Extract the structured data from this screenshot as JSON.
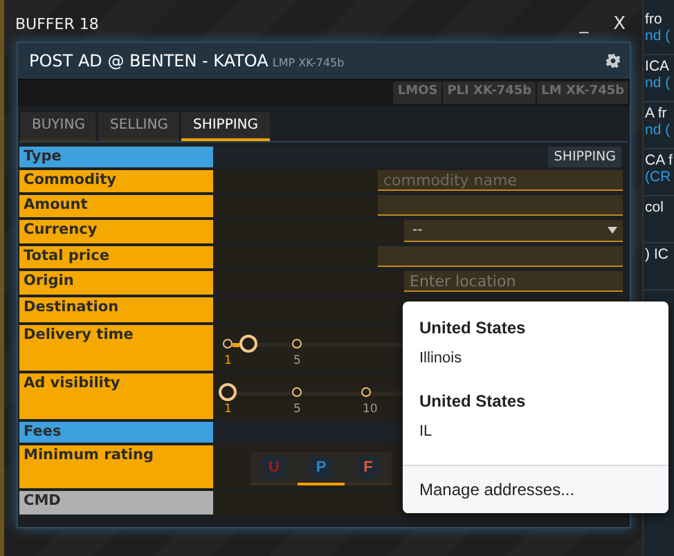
{
  "window": {
    "title": "BUFFER 18",
    "minimize": "_",
    "close": "X"
  },
  "panel": {
    "title": "POST AD @ BENTEN - KATOA",
    "subtitle": "LMP XK-745b"
  },
  "badges": [
    "LMOS",
    "PLI XK-745b",
    "LM XK-745b"
  ],
  "tabs": [
    {
      "label": "BUYING",
      "selected": false
    },
    {
      "label": "SELLING",
      "selected": false
    },
    {
      "label": "SHIPPING",
      "selected": true
    }
  ],
  "rows": [
    {
      "label": "Type",
      "kind": "section",
      "value": "SHIPPING"
    },
    {
      "label": "Commodity",
      "kind": "input",
      "placeholder": "commodity name"
    },
    {
      "label": "Amount",
      "kind": "input"
    },
    {
      "label": "Currency",
      "kind": "select",
      "value": "--"
    },
    {
      "label": "Total price",
      "kind": "input"
    },
    {
      "label": "Origin",
      "kind": "location",
      "placeholder": "Enter location"
    },
    {
      "label": "Destination",
      "kind": "empty"
    },
    {
      "label": "Delivery time",
      "kind": "slider",
      "level": 0.05,
      "ticks": [
        "1",
        "5"
      ]
    },
    {
      "label": "Ad visibility",
      "kind": "slider",
      "level": 0,
      "ticks": [
        "1",
        "5",
        "10"
      ]
    },
    {
      "label": "Fees",
      "kind": "section"
    },
    {
      "label": "Minimum rating",
      "kind": "rating",
      "options": [
        {
          "label": "U",
          "color": "#9b1c1c",
          "selected": false
        },
        {
          "label": "P",
          "color": "#2d86c8",
          "selected": true
        },
        {
          "label": "F",
          "color": "#e2553f",
          "selected": false
        }
      ]
    },
    {
      "label": "CMD",
      "kind": "command"
    }
  ],
  "suggestions": {
    "items": [
      {
        "title": "United States",
        "detail": "Illinois"
      },
      {
        "title": "United States",
        "detail": "IL"
      }
    ],
    "footer": "Manage addresses..."
  },
  "background_list": [
    {
      "lines": [
        {
          "text": "fro",
          "kind": "text"
        },
        {
          "text": "nd (",
          "kind": "link"
        }
      ]
    },
    {
      "lines": [
        {
          "text": "ICA",
          "kind": "text"
        },
        {
          "text": "nd (",
          "kind": "link"
        }
      ]
    },
    {
      "lines": [
        {
          "text": "A fr",
          "kind": "text"
        },
        {
          "text": "nd (",
          "kind": "link"
        }
      ]
    },
    {
      "lines": [
        {
          "text": "CA f",
          "kind": "text"
        },
        {
          "text": "(CR",
          "kind": "link"
        }
      ]
    },
    {
      "lines": [
        {
          "text": "col",
          "kind": "text"
        }
      ]
    },
    {
      "lines": [
        {
          "text": ") IC",
          "kind": "text"
        }
      ]
    }
  ]
}
